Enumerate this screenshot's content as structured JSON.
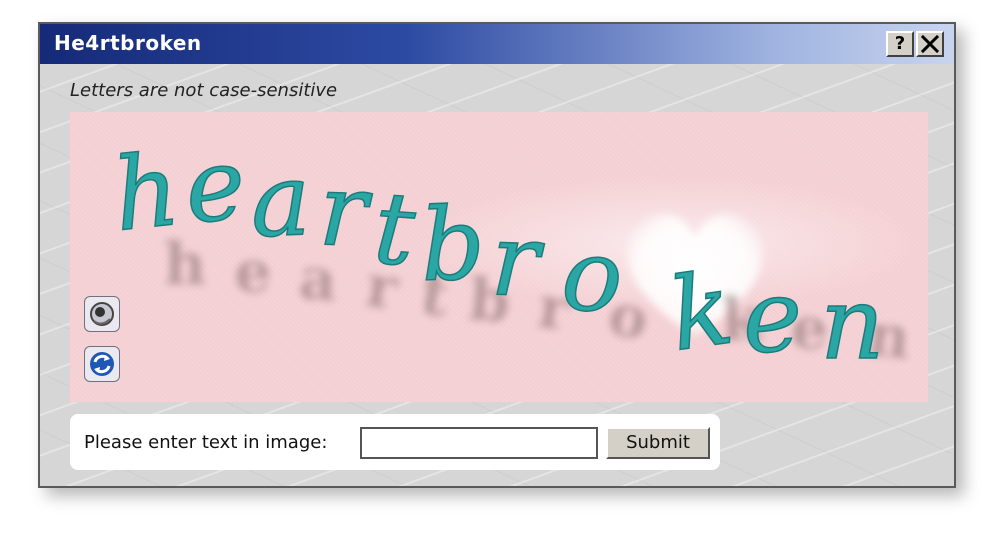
{
  "window": {
    "title": "He4rtbroken",
    "help_label": "?",
    "close_label": "✕"
  },
  "note": "Letters are not case-sensitive",
  "captcha": {
    "text": "heartbroken",
    "letter_color": "#2aa6a4",
    "background_color": "#f4cfd3",
    "audio_icon": "speaker-icon",
    "refresh_icon": "refresh-icon"
  },
  "form": {
    "label": "Please enter text in image:",
    "input_value": "",
    "submit_label": "Submit"
  }
}
